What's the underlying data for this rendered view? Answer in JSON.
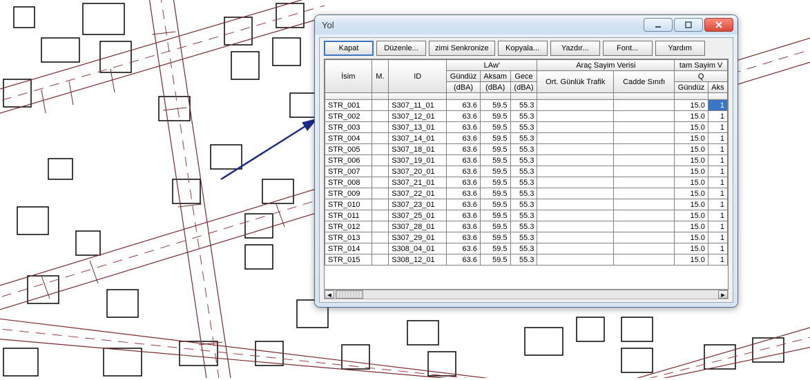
{
  "window": {
    "title": "Yol"
  },
  "toolbar": {
    "close_label": "Kapat",
    "edit_label": "Düzenle...",
    "sync_label": "zimi Senkronize",
    "copy_label": "Kopyala...",
    "print_label": "Yazdır...",
    "font_label": "Font...",
    "help_label": "Yardım"
  },
  "headers": {
    "r1": {
      "isim": "İsim",
      "m": "M.",
      "id": "ID",
      "law": "LAw'",
      "arac": "Araç Sayim Verisi",
      "tam": "tam Sayim V"
    },
    "r2": {
      "gunduz_dba": "Gündüz",
      "aksam_dba": "Aksam",
      "gece_dba": "Gece",
      "ort": "Ort. Günlük Trafik",
      "cadde": "Cadde Sınıfı",
      "q": "Q"
    },
    "r3": {
      "dba": "(dBA)",
      "gunduz": "Gündüz",
      "aks": "Aks"
    }
  },
  "rows": [
    {
      "isim": "STR_001",
      "id": "S307_11_01",
      "g": "63.6",
      "a": "59.5",
      "ge": "55.3",
      "q": "15.0",
      "qa": "1"
    },
    {
      "isim": "STR_002",
      "id": "S307_12_01",
      "g": "63.6",
      "a": "59.5",
      "ge": "55.3",
      "q": "15.0",
      "qa": "1"
    },
    {
      "isim": "STR_003",
      "id": "S307_13_01",
      "g": "63.6",
      "a": "59.5",
      "ge": "55.3",
      "q": "15.0",
      "qa": "1"
    },
    {
      "isim": "STR_004",
      "id": "S307_14_01",
      "g": "63.6",
      "a": "59.5",
      "ge": "55.3",
      "q": "15.0",
      "qa": "1"
    },
    {
      "isim": "STR_005",
      "id": "S307_18_01",
      "g": "63.6",
      "a": "59.5",
      "ge": "55.3",
      "q": "15.0",
      "qa": "1"
    },
    {
      "isim": "STR_006",
      "id": "S307_19_01",
      "g": "63.6",
      "a": "59.5",
      "ge": "55.3",
      "q": "15.0",
      "qa": "1"
    },
    {
      "isim": "STR_007",
      "id": "S307_20_01",
      "g": "63.6",
      "a": "59.5",
      "ge": "55.3",
      "q": "15.0",
      "qa": "1"
    },
    {
      "isim": "STR_008",
      "id": "S307_21_01",
      "g": "63.6",
      "a": "59.5",
      "ge": "55.3",
      "q": "15.0",
      "qa": "1"
    },
    {
      "isim": "STR_009",
      "id": "S307_22_01",
      "g": "63.6",
      "a": "59.5",
      "ge": "55.3",
      "q": "15.0",
      "qa": "1"
    },
    {
      "isim": "STR_010",
      "id": "S307_23_01",
      "g": "63.6",
      "a": "59.5",
      "ge": "55.3",
      "q": "15.0",
      "qa": "1"
    },
    {
      "isim": "STR_011",
      "id": "S307_25_01",
      "g": "63.6",
      "a": "59.5",
      "ge": "55.3",
      "q": "15.0",
      "qa": "1"
    },
    {
      "isim": "STR_012",
      "id": "S307_28_01",
      "g": "63.6",
      "a": "59.5",
      "ge": "55.3",
      "q": "15.0",
      "qa": "1"
    },
    {
      "isim": "STR_013",
      "id": "S307_29_01",
      "g": "63.6",
      "a": "59.5",
      "ge": "55.3",
      "q": "15.0",
      "qa": "1"
    },
    {
      "isim": "STR_014",
      "id": "S308_04_01",
      "g": "63.6",
      "a": "59.5",
      "ge": "55.3",
      "q": "15.0",
      "qa": "1"
    },
    {
      "isim": "STR_015",
      "id": "S308_12_01",
      "g": "63.6",
      "a": "59.5",
      "ge": "55.3",
      "q": "15.0",
      "qa": "1"
    }
  ]
}
